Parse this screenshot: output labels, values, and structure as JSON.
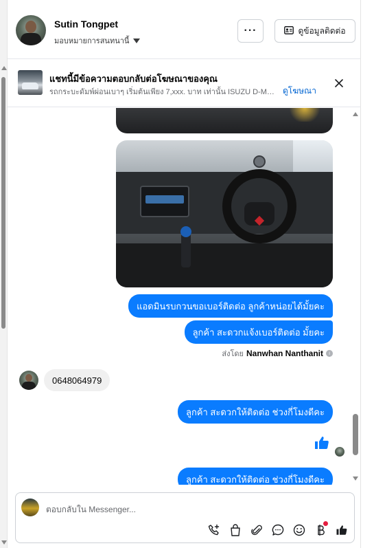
{
  "header": {
    "contact_name": "Sutin Tongpet",
    "assign_text": "มอบหมายการสนทนานี้",
    "more_label": "···",
    "view_contact_label": "ดูข้อมูลติดต่อ"
  },
  "ad_banner": {
    "title": "แชทนี้มีข้อความตอบกลับต่อโฆษณาของคุณ",
    "description": "รถกระบะดัมพ์ผ่อนเบาๆ เริ่มต้นเพียง 7,xxx. บาท เท่านั้น ISUZU D-MAX A...",
    "view_ad_label": "ดูโฆษณา"
  },
  "messages": {
    "out_1": "แอดมินรบกวนขอเบอร์ติดต่อ ลูกค้าหน่อยได้มั้ยคะ",
    "out_2": "ลูกค้า สะดวกแจ้งเบอร์ติดต่อ มั้ยคะ",
    "sent_by_prefix": "ส่งโดย",
    "sent_by_name": "Nanwhan Nanthanit",
    "in_1": "0648064979",
    "out_3": "ลูกค้า สะดวกให้ติดต่อ ช่วงกี่โมงดีคะ",
    "out_4": "ลูกค้า สะดวกให้ติดต่อ ช่วงกี่โมงดีคะ"
  },
  "composer": {
    "placeholder": "ตอบกลับใน Messenger..."
  },
  "icons": [
    "more-icon",
    "contact-card-icon",
    "close-icon",
    "like-icon",
    "info-icon",
    "call-add-icon",
    "bag-icon",
    "attach-icon",
    "chat-icon",
    "emoji-icon",
    "baht-icon",
    "thumbs-up-icon"
  ],
  "colors": {
    "outgoing_bubble": "#0a7cff",
    "incoming_bubble": "#f0f0f0",
    "link": "#0064d1",
    "notification_dot": "#e41e3f"
  }
}
